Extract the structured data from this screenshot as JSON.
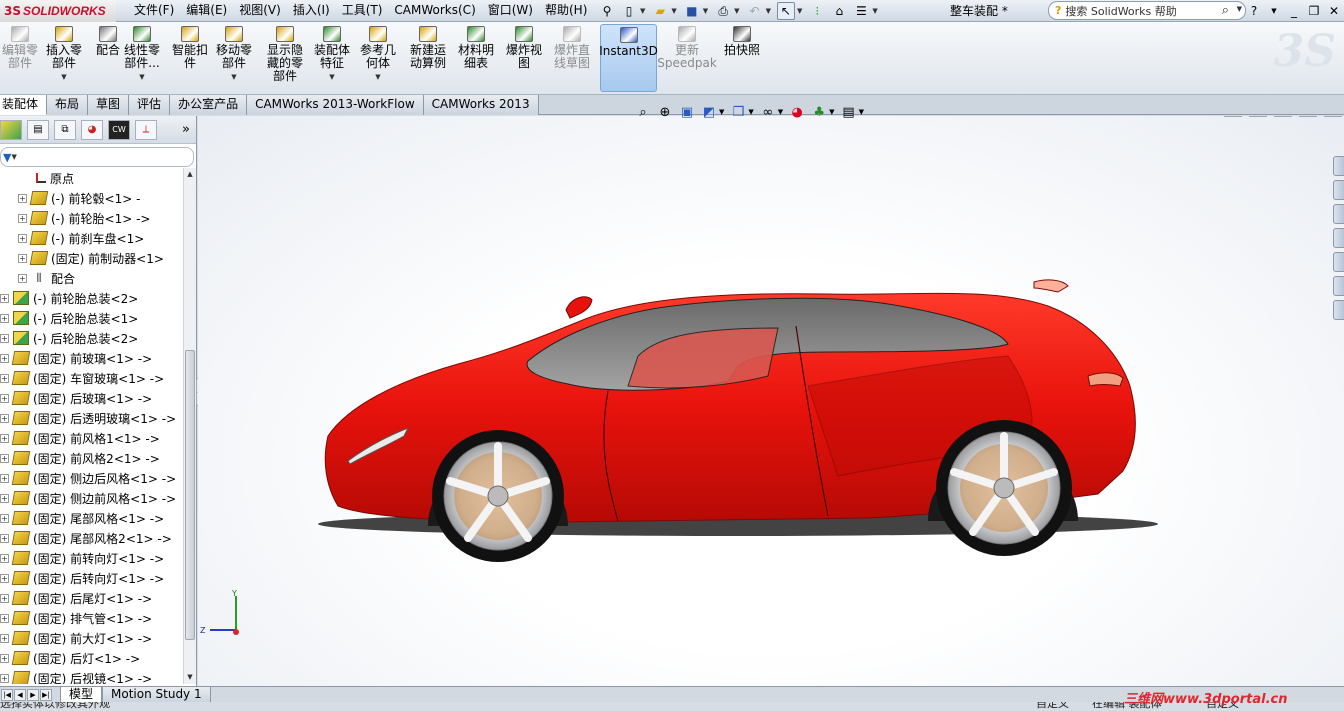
{
  "app": {
    "brand": "SOLIDWORKS",
    "document_title": "整车装配 *"
  },
  "menu": [
    "文件(F)",
    "编辑(E)",
    "视图(V)",
    "插入(I)",
    "工具(T)",
    "CAMWorks(C)",
    "窗口(W)",
    "帮助(H)"
  ],
  "search": {
    "placeholder": "搜索 SolidWorks 帮助"
  },
  "toolbar": [
    {
      "label": "编辑零\n部件",
      "icon": "edit-component-icon",
      "disabled": true
    },
    {
      "label": "插入零\n部件",
      "icon": "insert-component-icon",
      "arrow": true
    },
    {
      "label": "配合",
      "icon": "mate-icon"
    },
    {
      "label": "线性零\n部件...",
      "icon": "linear-pattern-icon",
      "arrow": true
    },
    {
      "label": "智能扣\n件",
      "icon": "smart-fasteners-icon"
    },
    {
      "label": "移动零\n部件",
      "icon": "move-component-icon",
      "arrow": true
    },
    {
      "label": "显示隐\n藏的零\n部件",
      "icon": "show-hidden-icon"
    },
    {
      "label": "装配体\n特征",
      "icon": "assembly-features-icon",
      "arrow": true
    },
    {
      "label": "参考几\n何体",
      "icon": "reference-geometry-icon",
      "arrow": true
    },
    {
      "label": "新建运\n动算例",
      "icon": "new-motion-study-icon"
    },
    {
      "label": "材料明\n细表",
      "icon": "bom-icon"
    },
    {
      "label": "爆炸视\n图",
      "icon": "exploded-view-icon"
    },
    {
      "label": "爆炸直\n线草图",
      "icon": "explode-line-sketch-icon",
      "disabled": true
    },
    {
      "label": "Instant3D",
      "icon": "instant3d-icon",
      "active": true
    },
    {
      "label": "更新\nSpeedpak",
      "icon": "update-speedpak-icon",
      "disabled": true
    },
    {
      "label": "拍快照",
      "icon": "snapshot-icon"
    }
  ],
  "tabs": [
    "装配体",
    "布局",
    "草图",
    "评估",
    "办公室产品",
    "CAMWorks 2013-WorkFlow",
    "CAMWorks 2013"
  ],
  "feature_tree": [
    {
      "label": "原点",
      "indent": 2,
      "icon": "origin",
      "exp": false
    },
    {
      "label": "(-) 前轮毂<1> -",
      "indent": 1,
      "icon": "part",
      "exp": true
    },
    {
      "label": "(-) 前轮胎<1> ->",
      "indent": 1,
      "icon": "part",
      "exp": true
    },
    {
      "label": "(-) 前刹车盘<1>",
      "indent": 1,
      "icon": "part",
      "exp": true
    },
    {
      "label": "(固定) 前制动器<1>",
      "indent": 1,
      "icon": "part",
      "exp": true
    },
    {
      "label": "配合",
      "indent": 1,
      "icon": "mate",
      "exp": true
    },
    {
      "label": "(-) 前轮胎总装<2>",
      "indent": 0,
      "icon": "asm",
      "exp": true
    },
    {
      "label": "(-) 后轮胎总装<1>",
      "indent": 0,
      "icon": "asm",
      "exp": true
    },
    {
      "label": "(-) 后轮胎总装<2>",
      "indent": 0,
      "icon": "asm",
      "exp": true
    },
    {
      "label": "(固定) 前玻璃<1> ->",
      "indent": 0,
      "icon": "part",
      "exp": true
    },
    {
      "label": "(固定) 车窗玻璃<1> ->",
      "indent": 0,
      "icon": "part",
      "exp": true
    },
    {
      "label": "(固定) 后玻璃<1> ->",
      "indent": 0,
      "icon": "part",
      "exp": true
    },
    {
      "label": "(固定) 后透明玻璃<1> ->",
      "indent": 0,
      "icon": "part",
      "exp": true
    },
    {
      "label": "(固定) 前风格1<1> ->",
      "indent": 0,
      "icon": "part",
      "exp": true
    },
    {
      "label": "(固定) 前风格2<1> ->",
      "indent": 0,
      "icon": "part",
      "exp": true
    },
    {
      "label": "(固定) 侧边后风格<1> ->",
      "indent": 0,
      "icon": "part",
      "exp": true
    },
    {
      "label": "(固定) 侧边前风格<1> ->",
      "indent": 0,
      "icon": "part",
      "exp": true
    },
    {
      "label": "(固定) 尾部风格<1> ->",
      "indent": 0,
      "icon": "part",
      "exp": true
    },
    {
      "label": "(固定) 尾部风格2<1> ->",
      "indent": 0,
      "icon": "part",
      "exp": true
    },
    {
      "label": "(固定) 前转向灯<1> ->",
      "indent": 0,
      "icon": "part",
      "exp": true
    },
    {
      "label": "(固定) 后转向灯<1> ->",
      "indent": 0,
      "icon": "part",
      "exp": true
    },
    {
      "label": "(固定) 后尾灯<1> ->",
      "indent": 0,
      "icon": "part",
      "exp": true
    },
    {
      "label": "(固定) 排气管<1> ->",
      "indent": 0,
      "icon": "part",
      "exp": true
    },
    {
      "label": "(固定) 前大灯<1> ->",
      "indent": 0,
      "icon": "part",
      "exp": true
    },
    {
      "label": "(固定) 后灯<1> ->",
      "indent": 0,
      "icon": "part",
      "exp": true
    },
    {
      "label": "(固定) 后视镜<1> ->",
      "indent": 0,
      "icon": "part",
      "exp": true
    }
  ],
  "triad": {
    "x": "",
    "y": "Y",
    "z": "Z"
  },
  "bottom_tabs": [
    "模型",
    "Motion Study 1"
  ],
  "status": {
    "left": "选择实体以修改其外观",
    "mid1": "自定义",
    "mid2": "在编辑 装配体",
    "right": "自定义"
  },
  "watermark": "三维网www.3dportal.cn",
  "colors": {
    "car_body": "#e8120c",
    "accent": "#c8102e"
  }
}
